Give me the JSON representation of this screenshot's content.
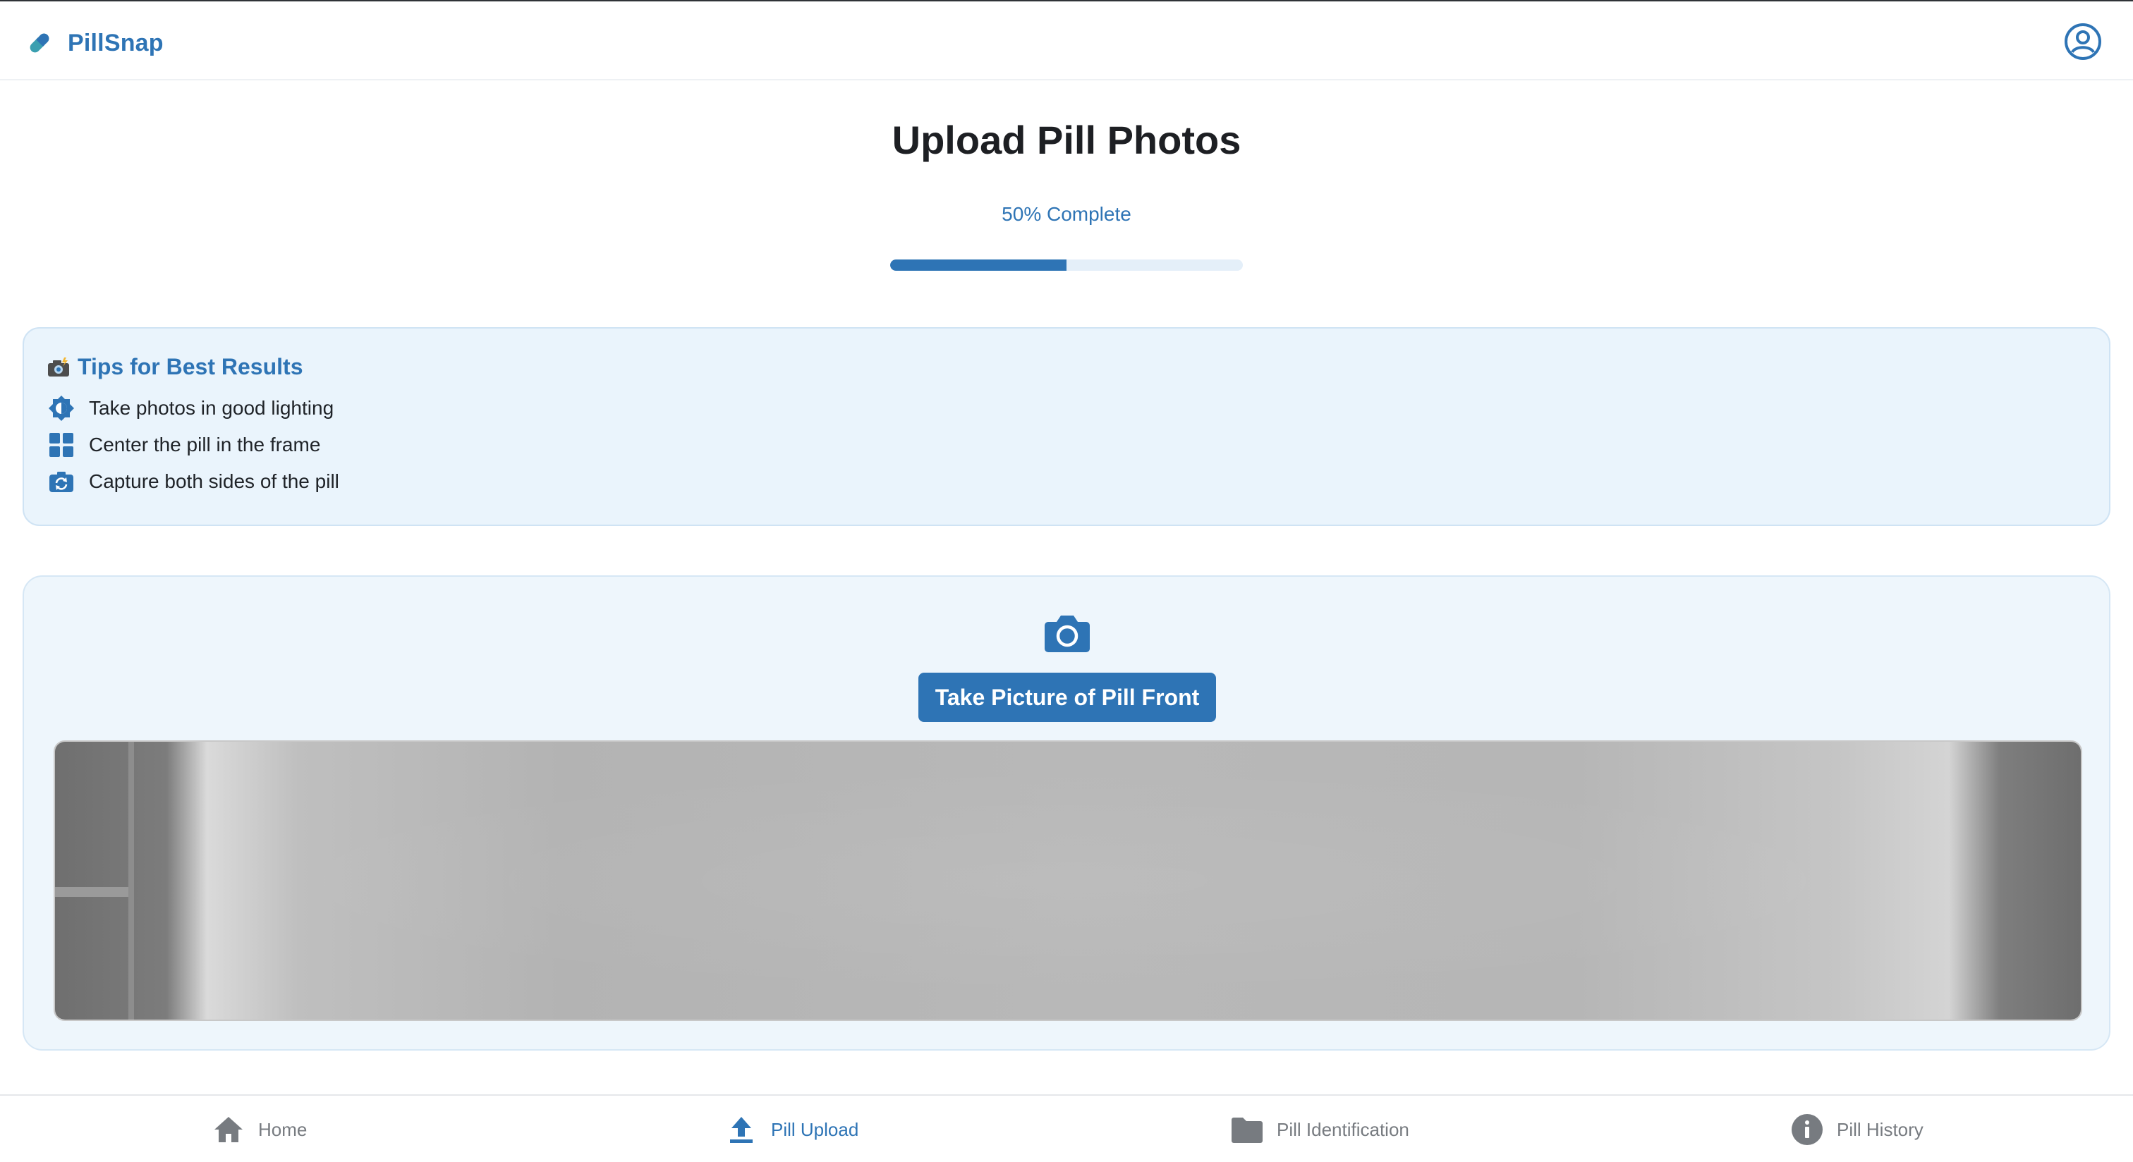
{
  "app": {
    "name": "PillSnap"
  },
  "header": {
    "brand_icon": "pill-icon",
    "profile_icon": "user-circle-icon"
  },
  "main": {
    "title": "Upload Pill Photos",
    "progress_label": "50% Complete",
    "progress_fraction": 0.5
  },
  "tips": {
    "title_emoji": "camera-with-flash-icon",
    "title": "Tips for Best Results",
    "items": [
      {
        "icon": "brightness-icon",
        "text": "Take photos in good lighting"
      },
      {
        "icon": "grid-icon",
        "text": "Center the pill in the frame"
      },
      {
        "icon": "camera-rotate-icon",
        "text": "Capture both sides of the pill"
      }
    ]
  },
  "upload": {
    "icon": "camera-icon",
    "button_label": "Take Picture of Pill Front"
  },
  "bottom_nav": {
    "items": [
      {
        "icon": "home-icon",
        "label": "Home",
        "active": false
      },
      {
        "icon": "upload-icon",
        "label": "Pill Upload",
        "active": true
      },
      {
        "icon": "folder-icon",
        "label": "Pill Identification",
        "active": false
      },
      {
        "icon": "info-icon",
        "label": "Pill History",
        "active": false
      }
    ]
  },
  "colors": {
    "accent": "#2e74b5",
    "tips_bg": "#eaf4fc",
    "nav_inactive": "#777b80"
  }
}
